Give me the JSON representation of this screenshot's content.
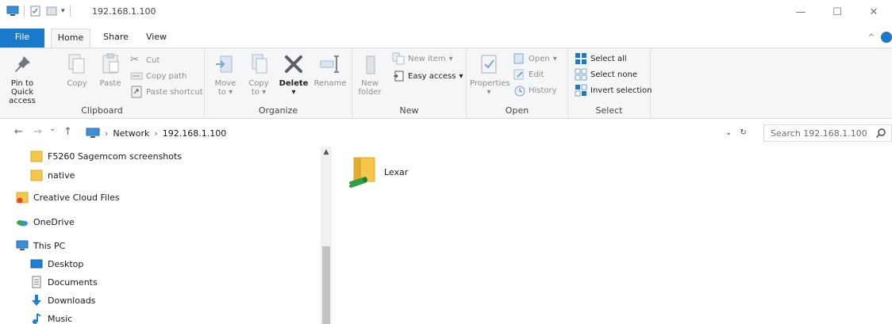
{
  "window": {
    "title": "192.168.1.100",
    "minimize_glyph": "—",
    "maximize_glyph": "☐",
    "close_glyph": "✕"
  },
  "ribbon_tabs": [
    {
      "label": "File"
    },
    {
      "label": "Home"
    },
    {
      "label": "Share"
    },
    {
      "label": "View"
    }
  ],
  "ribbon_collapse_glyph": "^",
  "clipboard": {
    "pin_label": "Pin to Quick access",
    "copy_label": "Copy",
    "paste_label": "Paste",
    "cut_label": "Cut",
    "copy_path_label": "Copy path",
    "paste_shortcut_label": "Paste shortcut",
    "group_label": "Clipboard"
  },
  "organize": {
    "move_to_label": "Move to",
    "copy_to_label": "Copy to",
    "delete_label": "Delete",
    "rename_label": "Rename",
    "group_label": "Organize"
  },
  "new_group": {
    "new_folder_label": "New folder",
    "new_item_label": "New item",
    "easy_access_label": "Easy access",
    "group_label": "New"
  },
  "open_group": {
    "properties_label": "Properties",
    "open_label": "Open",
    "edit_label": "Edit",
    "history_label": "History",
    "group_label": "Open"
  },
  "select_group": {
    "select_all_label": "Select all",
    "select_none_label": "Select none",
    "invert_selection_label": "Invert selection",
    "group_label": "Select"
  },
  "address_bar": {
    "back_glyph": "←",
    "forward_glyph": "→",
    "recent_glyph": "⌄",
    "up_glyph": "↑",
    "crumbs": [
      "Network",
      "192.168.1.100"
    ],
    "crumb_separator": "›",
    "dropdown_glyph": "⌄",
    "refresh_glyph": "↻"
  },
  "search": {
    "placeholder": "Search 192.168.1.100"
  },
  "nav_pane": {
    "items": [
      {
        "label": "F5260 Sagemcom screenshots",
        "icon": "folder-icon"
      },
      {
        "label": "native",
        "icon": "folder-icon"
      },
      {
        "label": "Creative Cloud Files",
        "icon": "creative-cloud-icon"
      },
      {
        "label": "OneDrive",
        "icon": "onedrive-icon"
      },
      {
        "label": "This PC",
        "icon": "this-pc-icon"
      },
      {
        "label": "Desktop",
        "icon": "desktop-icon"
      },
      {
        "label": "Documents",
        "icon": "documents-icon"
      },
      {
        "label": "Downloads",
        "icon": "downloads-icon"
      },
      {
        "label": "Music",
        "icon": "music-icon"
      }
    ]
  },
  "content": {
    "items": [
      {
        "label": "Lexar",
        "icon": "network-share-folder-icon"
      }
    ]
  },
  "colors": {
    "accent": "#1979ca",
    "folder": "#f5c84c",
    "ribbon_bg": "#f5f6f7"
  }
}
